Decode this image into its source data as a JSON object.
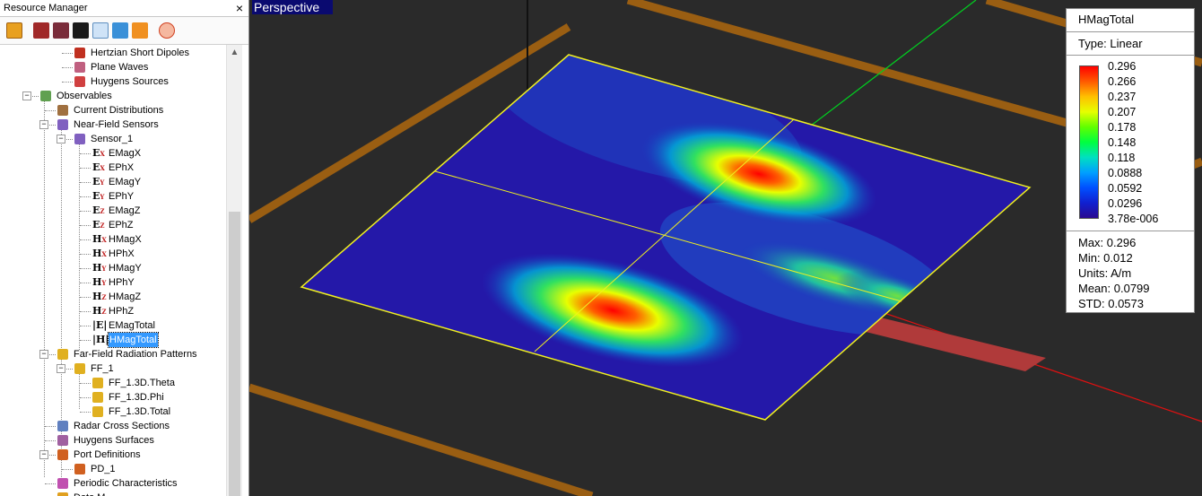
{
  "resource_manager": {
    "title": "Resource Manager",
    "close": "×",
    "tree": [
      {
        "label": "Hertzian Short Dipoles",
        "icon": "hertzian-dipole-icon"
      },
      {
        "label": "Plane Waves",
        "icon": "plane-wave-icon"
      },
      {
        "label": "Huygens Sources",
        "icon": "huygens-source-icon"
      },
      {
        "label": "Observables",
        "icon": "observables-icon"
      },
      {
        "label": "Current Distributions",
        "icon": "current-distribution-icon"
      },
      {
        "label": "Near-Field Sensors",
        "icon": "near-field-sensor-icon"
      },
      {
        "label": "Sensor_1",
        "icon": "sensor-icon"
      },
      {
        "label": "EMagX",
        "glyph": "E",
        "sub": "X"
      },
      {
        "label": "EPhX",
        "glyph": "E",
        "sub": "X"
      },
      {
        "label": "EMagY",
        "glyph": "E",
        "sub": "Y"
      },
      {
        "label": "EPhY",
        "glyph": "E",
        "sub": "Y"
      },
      {
        "label": "EMagZ",
        "glyph": "E",
        "sub": "Z"
      },
      {
        "label": "EPhZ",
        "glyph": "E",
        "sub": "Z"
      },
      {
        "label": "HMagX",
        "glyph": "H",
        "sub": "X"
      },
      {
        "label": "HPhX",
        "glyph": "H",
        "sub": "X"
      },
      {
        "label": "HMagY",
        "glyph": "H",
        "sub": "Y"
      },
      {
        "label": "HPhY",
        "glyph": "H",
        "sub": "Y"
      },
      {
        "label": "HMagZ",
        "glyph": "H",
        "sub": "Z"
      },
      {
        "label": "HPhZ",
        "glyph": "H",
        "sub": "Z"
      },
      {
        "label": "EMagTotal",
        "glyph": "|E|"
      },
      {
        "label": "HMagTotal",
        "glyph": "|H|",
        "selected": true
      },
      {
        "label": "Far-Field Radiation Patterns",
        "icon": "far-field-icon"
      },
      {
        "label": "FF_1",
        "icon": "far-field-icon"
      },
      {
        "label": "FF_1.3D.Theta",
        "icon": "far-field-icon"
      },
      {
        "label": "FF_1.3D.Phi",
        "icon": "far-field-icon"
      },
      {
        "label": "FF_1.3D.Total",
        "icon": "far-field-icon"
      },
      {
        "label": "Radar Cross Sections",
        "icon": "radar-icon"
      },
      {
        "label": "Huygens Surfaces",
        "icon": "huygens-surface-icon"
      },
      {
        "label": "Port Definitions",
        "icon": "port-icon"
      },
      {
        "label": "PD_1",
        "icon": "port-icon"
      },
      {
        "label": "Periodic Characteristics",
        "icon": "periodic-icon"
      },
      {
        "label": "Data M",
        "icon": "data-icon"
      }
    ]
  },
  "viewport": {
    "label": "Perspective"
  },
  "legend": {
    "title": "HMagTotal",
    "type": "Type: Linear",
    "ticks": [
      "0.296",
      "0.266",
      "0.237",
      "0.207",
      "0.178",
      "0.148",
      "0.118",
      "0.0888",
      "0.0592",
      "0.0296",
      "3.78e-006"
    ],
    "stats": [
      "Max: 0.296",
      "Min: 0.012",
      "Units: A/m",
      "Mean: 0.0799",
      "STD: 0.0573"
    ]
  }
}
